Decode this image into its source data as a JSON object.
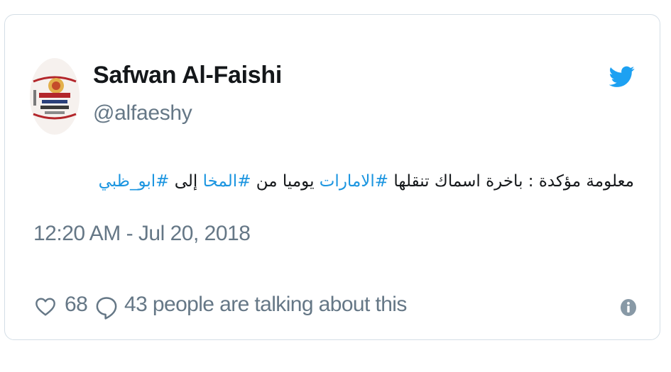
{
  "tweet": {
    "author": {
      "display_name": "Safwan Al-Faishi",
      "handle": "@alfaeshy"
    },
    "text_segments": [
      {
        "text": "معلومة مؤكدة : باخرة اسماك تنقلها ",
        "hashtag": false
      },
      {
        "text": "#الامارات",
        "hashtag": true
      },
      {
        "text": " يوميا من ",
        "hashtag": false
      },
      {
        "text": "#المخا",
        "hashtag": true
      },
      {
        "text": " إلى ",
        "hashtag": false
      },
      {
        "text": "#ابو_ظبي",
        "hashtag": true
      }
    ],
    "timestamp": "12:20 AM - Jul 20, 2018",
    "likes": "68",
    "talking": "43 people are talking about this"
  },
  "icons": {
    "brand": "twitter-bird-icon",
    "like": "heart-icon",
    "reply": "reply-bubble-icon",
    "info": "info-icon"
  },
  "colors": {
    "brand_blue": "#1da1f2",
    "hashtag": "#1b95e0",
    "text": "#14171a",
    "muted": "#657786",
    "border": "#d4dee6"
  }
}
